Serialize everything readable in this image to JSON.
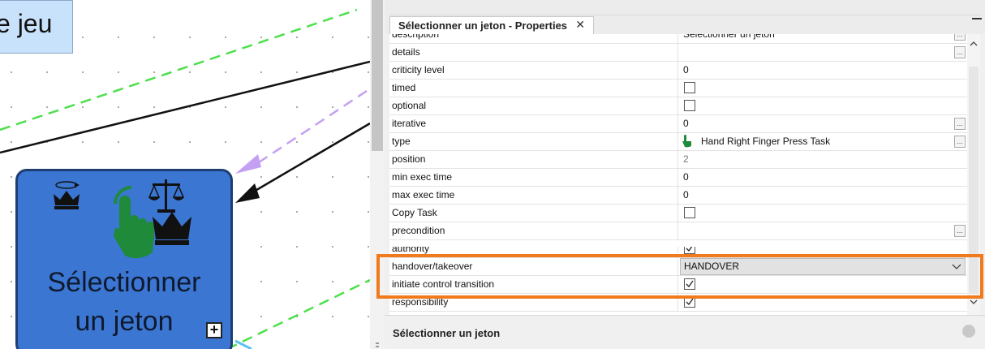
{
  "canvas": {
    "title_fragment": "e jeu",
    "task": {
      "label_line1": "Sélectionner",
      "label_line2": "un jeton",
      "expand": "+"
    }
  },
  "panel": {
    "tab_title": "Sélectionner un jeton - Properties",
    "tab_close": "✕",
    "footer_title": "Sélectionner un jeton",
    "properties": [
      {
        "name": "description",
        "value": "Sélectionner un jeton"
      },
      {
        "name": "details",
        "value": ""
      },
      {
        "name": "criticity level",
        "value": "0"
      },
      {
        "name": "timed",
        "checked": false
      },
      {
        "name": "optional",
        "checked": false
      },
      {
        "name": "iterative",
        "value": "0"
      },
      {
        "name": "type",
        "value": "Hand Right Finger Press Task"
      },
      {
        "name": "position",
        "value": "2"
      },
      {
        "name": "min exec time",
        "value": "0"
      },
      {
        "name": "max exec time",
        "value": "0"
      },
      {
        "name": "Copy Task",
        "checked": false
      },
      {
        "name": "precondition",
        "value": ""
      },
      {
        "name": "authority",
        "checked": true
      },
      {
        "name": "handover/takeover",
        "value": "HANDOVER"
      },
      {
        "name": "initiate control transition",
        "checked": true
      },
      {
        "name": "responsibility",
        "checked": true
      }
    ],
    "ellipsis": "..."
  },
  "colors": {
    "task_fill": "#3b76d2",
    "highlight": "#f07a1c",
    "title_box": "#c9e2fb"
  }
}
